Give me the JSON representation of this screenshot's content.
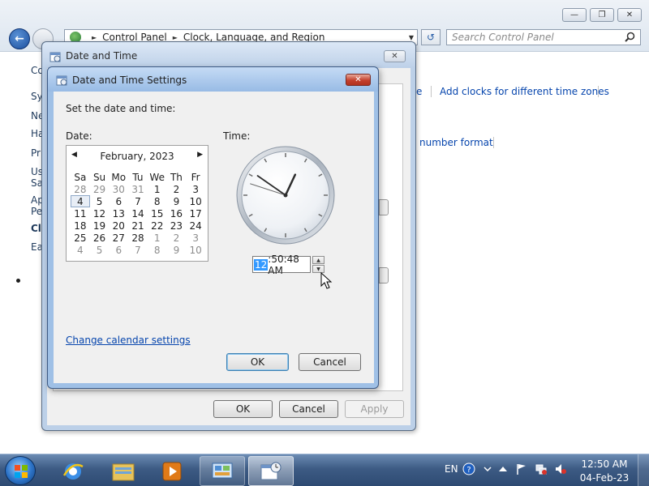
{
  "control_panel": {
    "breadcrumb": [
      "Control Panel",
      "Clock, Language, and Region"
    ],
    "search_placeholder": "Search Control Panel",
    "sidebar_fragments": [
      "Co",
      "Sy",
      "Ne",
      "Ha",
      "Pr",
      "Us",
      "Sa",
      "Ap",
      "Pe",
      "Cl",
      "Ea"
    ],
    "links": {
      "fragment_e": "e",
      "add_clocks": "Add clocks for different time zones",
      "number_format": "number format"
    }
  },
  "date_time_dialog": {
    "title": "Date and Time",
    "ok_label": "OK",
    "cancel_label": "Cancel",
    "apply_label": "Apply"
  },
  "settings_dialog": {
    "title": "Date and Time Settings",
    "instruction": "Set the date and time:",
    "date_label": "Date:",
    "time_label": "Time:",
    "calendar": {
      "month_label": "February, 2023",
      "weekdays": [
        "Sa",
        "Su",
        "Mo",
        "Tu",
        "We",
        "Th",
        "Fr"
      ],
      "days": [
        {
          "n": "28",
          "other": true
        },
        {
          "n": "29",
          "other": true
        },
        {
          "n": "30",
          "other": true
        },
        {
          "n": "31",
          "other": true
        },
        {
          "n": "1"
        },
        {
          "n": "2"
        },
        {
          "n": "3"
        },
        {
          "n": "4",
          "selected": true
        },
        {
          "n": "5"
        },
        {
          "n": "6"
        },
        {
          "n": "7"
        },
        {
          "n": "8"
        },
        {
          "n": "9"
        },
        {
          "n": "10"
        },
        {
          "n": "11"
        },
        {
          "n": "12"
        },
        {
          "n": "13"
        },
        {
          "n": "14"
        },
        {
          "n": "15"
        },
        {
          "n": "16"
        },
        {
          "n": "17"
        },
        {
          "n": "18"
        },
        {
          "n": "19"
        },
        {
          "n": "20"
        },
        {
          "n": "21"
        },
        {
          "n": "22"
        },
        {
          "n": "23"
        },
        {
          "n": "24"
        },
        {
          "n": "25"
        },
        {
          "n": "26"
        },
        {
          "n": "27"
        },
        {
          "n": "28"
        },
        {
          "n": "1",
          "other": true
        },
        {
          "n": "2",
          "other": true
        },
        {
          "n": "3",
          "other": true
        },
        {
          "n": "4",
          "other": true
        },
        {
          "n": "5",
          "other": true
        },
        {
          "n": "6",
          "other": true
        },
        {
          "n": "7",
          "other": true
        },
        {
          "n": "8",
          "other": true
        },
        {
          "n": "9",
          "other": true
        },
        {
          "n": "10",
          "other": true
        }
      ]
    },
    "clock": {
      "hour": 12,
      "minute": 50,
      "second": 48
    },
    "time_input": {
      "hour": "12",
      "rest": ":50:48 AM"
    },
    "calendar_settings_link": "Change calendar settings",
    "ok_label": "OK",
    "cancel_label": "Cancel"
  },
  "taskbar": {
    "apps": [
      "internet-explorer",
      "windows-explorer",
      "media-player",
      "control-panel",
      "date-and-time"
    ],
    "language": "EN",
    "time": "12:50 AM",
    "date": "04-Feb-23"
  }
}
